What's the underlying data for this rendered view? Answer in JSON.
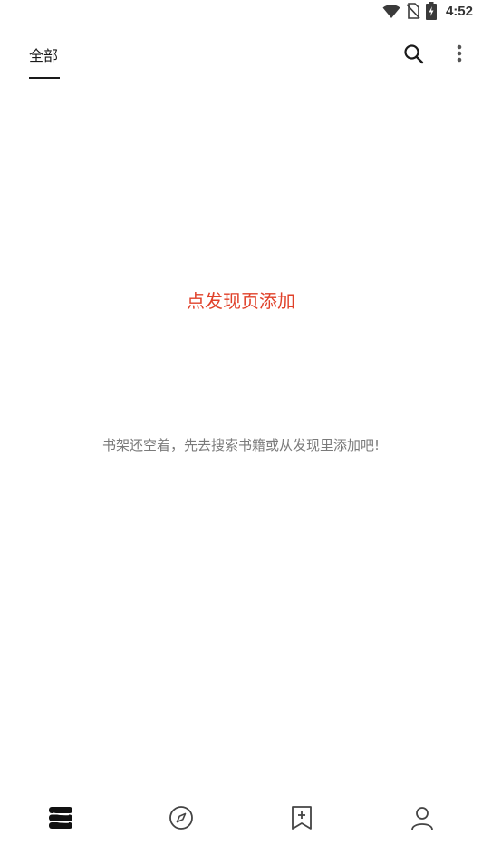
{
  "status_bar": {
    "time": "4:52",
    "icons": [
      "wifi-icon",
      "no-sim-icon",
      "battery-charging-icon"
    ]
  },
  "top_bar": {
    "tab_all_label": "全部",
    "actions": [
      "search-icon",
      "more-vert-icon"
    ]
  },
  "empty_state": {
    "add_link": "点发现页添加",
    "message": "书架还空着，先去搜索书籍或从发现里添加吧!"
  },
  "bottom_nav": {
    "items": [
      "bookshelf-icon",
      "discover-compass-icon",
      "bookmark-add-icon",
      "profile-icon"
    ],
    "active_index": 0
  },
  "colors": {
    "accent_red": "#e0412a",
    "text_primary": "#1a1a1a",
    "text_secondary": "#7a7a7a"
  }
}
